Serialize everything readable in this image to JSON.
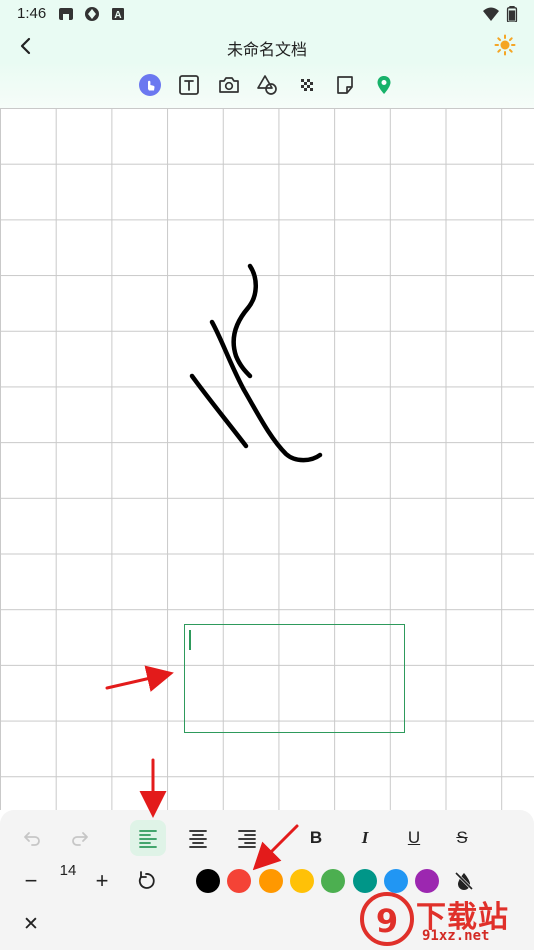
{
  "status_bar": {
    "time": "1:46",
    "icons": [
      "notification-icon",
      "sync-icon",
      "a-badge-icon"
    ],
    "right_icons": [
      "wifi-icon",
      "battery-icon"
    ]
  },
  "header": {
    "title": "未命名文档",
    "back_icon": "chevron-left-icon",
    "theme_icon": "sun-icon"
  },
  "toolbar": {
    "tools": [
      "touch-icon",
      "text-tool-icon",
      "camera-icon",
      "shapes-icon",
      "mosaic-icon",
      "sticky-note-icon",
      "location-pin-icon"
    ],
    "active_color": "#6b78f0",
    "location_color": "#17b26a"
  },
  "text_panel": {
    "font_size": "14",
    "bold_label": "B",
    "italic_label": "I",
    "underline_label": "U",
    "strike_label": "S",
    "minus_label": "−",
    "plus_label": "+",
    "close_label": "✕",
    "colors": [
      "#000000",
      "#f44336",
      "#ff9800",
      "#ffc107",
      "#4caf50",
      "#009688",
      "#2196f3",
      "#9c27b0"
    ],
    "active_align": "left"
  },
  "watermark": {
    "text": "下载站",
    "domain": "91xz.net"
  }
}
